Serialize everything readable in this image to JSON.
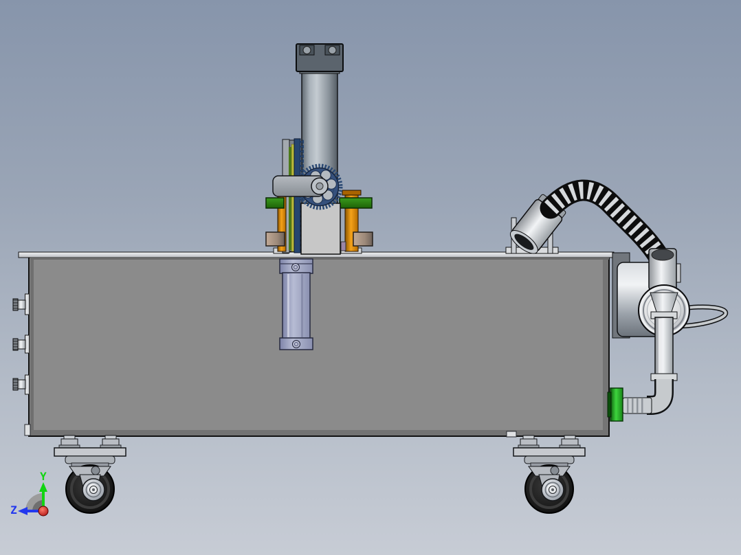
{
  "scene": {
    "name": "cad-assembly-side-view",
    "description_parts": [
      "equipment-cabinet",
      "deck-plate",
      "pneumatic-cylinder",
      "cylinder-top-cap",
      "drive-gear",
      "rack-guide",
      "lever-arm",
      "guide-post-left",
      "guide-post-right",
      "green-guide-plates",
      "tan-spring-seats",
      "lift-cylinder",
      "suction-nozzle",
      "flexible-hose",
      "pump-motor",
      "pump-volute",
      "drain-pipe",
      "hose-barb-fitting",
      "tank-fitting",
      "side-knobs",
      "caster-front",
      "caster-rear",
      "orientation-triad"
    ]
  },
  "triad": {
    "y_label": "Y",
    "z_label": "Z",
    "y_color": "#12d412",
    "z_color": "#2338ee",
    "origin_color": "#c21414",
    "disc_color": "#9c9c9c"
  },
  "palette": {
    "background_top": "#8795ab",
    "background_bottom": "#c7ccd5",
    "box_face": "#8b8b8b",
    "deck": "#e9eaec",
    "cylinder_cap": "#5b646d",
    "cylinder_barrel": "#aab3bb",
    "gear_navy": "#35507c",
    "rack_navy": "#26456f",
    "strip_yellow": "#b9b93a",
    "guide_green": "#2f8a12",
    "post_orange": "#e89b06",
    "block_tan": "#a8927e",
    "lift_lavender": "#a2a7c4",
    "hose_black": "#141414",
    "hose_ring": "#d6d9dc",
    "pump_metal": "#c9cdd1",
    "fitting_green": "#2fc42f",
    "tire_black": "#161616"
  }
}
